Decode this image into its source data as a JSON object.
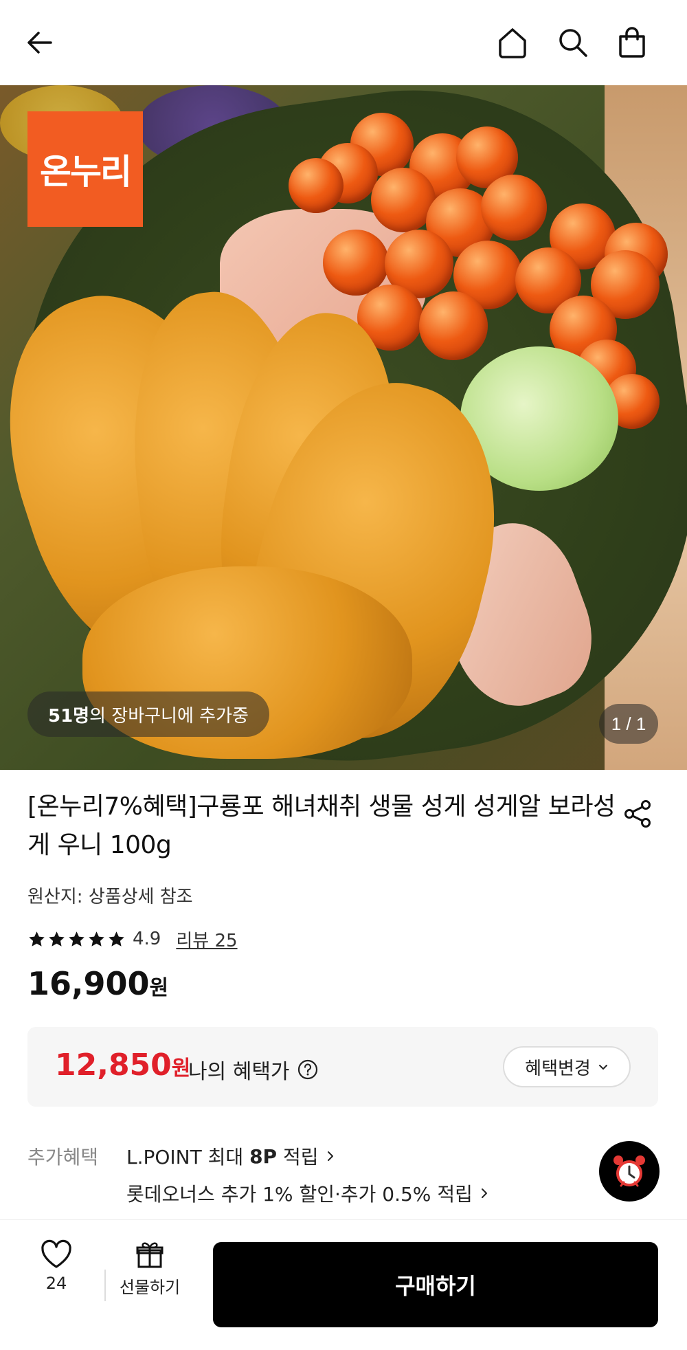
{
  "header": {
    "icons": [
      "back-arrow-icon",
      "home-icon",
      "search-icon",
      "shopping-bag-icon"
    ]
  },
  "hero": {
    "logo_text": "온누리",
    "cart_count": "51명",
    "cart_text": "의 장바구니에 추가중",
    "page_indicator": "1 / 1"
  },
  "product": {
    "title": "[온누리7%혜택]구룡포 해녀채취 생물 성게 성게알 보라성게 우니 100g",
    "origin": "원산지: 상품상세 참조",
    "rating": "4.9",
    "stars": 5,
    "review_link": "리뷰 25",
    "price": "16,900",
    "price_unit": "원"
  },
  "benefit": {
    "price": "12,850",
    "price_unit": "원",
    "label": "나의 혜택가",
    "change_button": "혜택변경"
  },
  "extra": {
    "label": "추가혜택",
    "line1_prefix": "L.POINT 최대 ",
    "line1_bold": "8P",
    "line1_suffix": " 적립",
    "line2": "롯데오너스 추가 1% 할인·추가 0.5% 적립"
  },
  "bottom": {
    "wish_count": "24",
    "gift_label": "선물하기",
    "buy_label": "구매하기"
  },
  "colors": {
    "accent_red": "#e0202a",
    "logo_orange": "#f25c22",
    "button_black": "#000000"
  }
}
